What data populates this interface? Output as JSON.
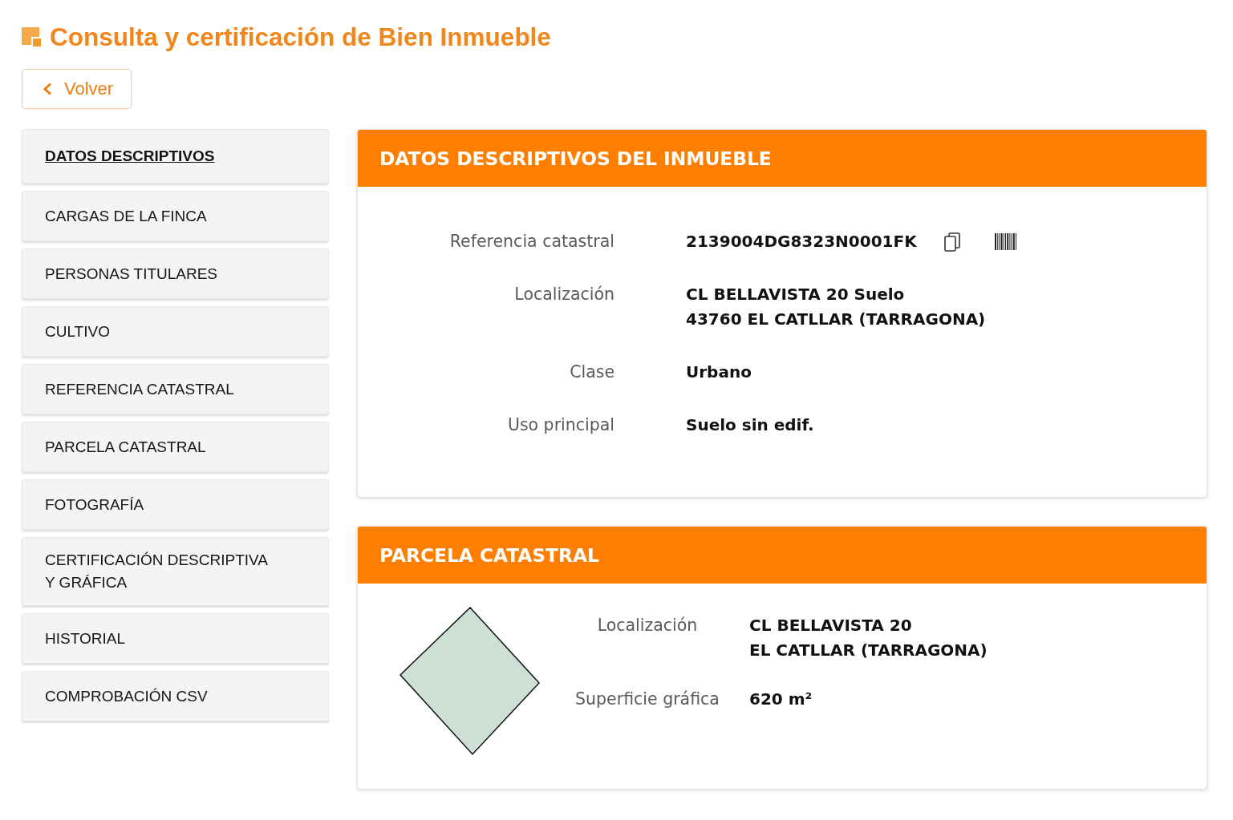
{
  "page": {
    "title": "Consulta y certificación de Bien Inmueble",
    "back_button": "Volver"
  },
  "sidebar": {
    "items": [
      {
        "label": "DATOS DESCRIPTIVOS",
        "selected": true
      },
      {
        "label": "CARGAS DE LA FINCA",
        "selected": false
      },
      {
        "label": "PERSONAS TITULARES",
        "selected": false
      },
      {
        "label": "CULTIVO",
        "selected": false
      },
      {
        "label": "REFERENCIA CATASTRAL",
        "selected": false
      },
      {
        "label": "PARCELA CATASTRAL",
        "selected": false
      },
      {
        "label": "FOTOGRAFÍA",
        "selected": false
      },
      {
        "label": "CERTIFICACIÓN DESCRIPTIVA Y GRÁFICA",
        "selected": false
      },
      {
        "label": "HISTORIAL",
        "selected": false
      },
      {
        "label": "COMPROBACIÓN CSV",
        "selected": false
      }
    ]
  },
  "cards": [
    {
      "kind": "property",
      "title": "DATOS DESCRIPTIVOS DEL INMUEBLE",
      "fields": [
        {
          "kind": "reference",
          "label": "Referencia catastral",
          "value_lines": [
            "2139004DG8323N0001FK"
          ]
        },
        {
          "kind": "text",
          "label": "Localización",
          "value_lines": [
            "CL BELLAVISTA 20 Suelo",
            "43760 EL CATLLAR (TARRAGONA)"
          ]
        },
        {
          "kind": "text",
          "label": "Clase",
          "value_lines": [
            "Urbano"
          ]
        },
        {
          "kind": "text",
          "label": "Uso principal",
          "value_lines": [
            "Suelo sin edif."
          ]
        }
      ]
    },
    {
      "kind": "parcel",
      "title": "PARCELA CATASTRAL",
      "fields": [
        {
          "kind": "text",
          "label": "Localización",
          "value_lines": [
            "CL BELLAVISTA 20",
            "EL CATLLAR (TARRAGONA)"
          ]
        },
        {
          "kind": "text",
          "label": "Superficie gráfica",
          "value_lines": [
            "620 m²"
          ]
        }
      ]
    }
  ]
}
